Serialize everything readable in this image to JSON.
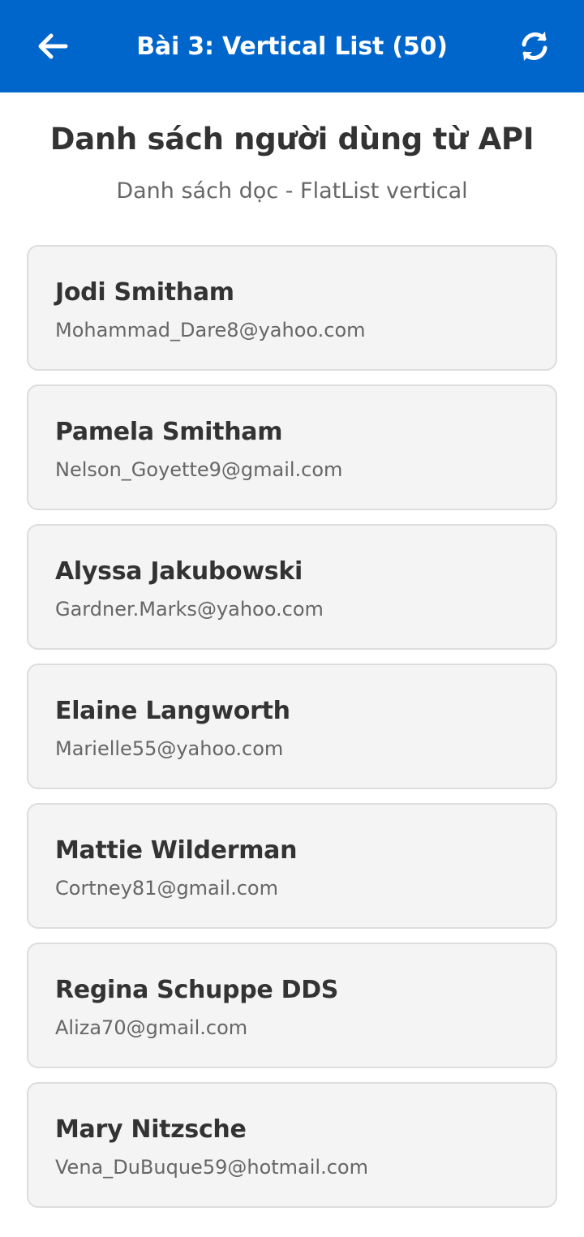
{
  "header": {
    "title": "Bài 3: Vertical List (50)",
    "back_icon": "arrow-left-icon",
    "refresh_icon": "refresh-icon",
    "background": "#0066CC"
  },
  "main": {
    "title": "Danh sách người dùng từ API",
    "subtitle": "Danh sách dọc - FlatList vertical"
  },
  "users": [
    {
      "name": "Jodi Smitham",
      "email": "Mohammad_Dare8@yahoo.com"
    },
    {
      "name": "Pamela Smitham",
      "email": "Nelson_Goyette9@gmail.com"
    },
    {
      "name": "Alyssa Jakubowski",
      "email": "Gardner.Marks@yahoo.com"
    },
    {
      "name": "Elaine Langworth",
      "email": "Marielle55@yahoo.com"
    },
    {
      "name": "Mattie Wilderman",
      "email": "Cortney81@gmail.com"
    },
    {
      "name": "Regina Schuppe DDS",
      "email": "Aliza70@gmail.com"
    },
    {
      "name": "Mary Nitzsche",
      "email": "Vena_DuBuque59@hotmail.com"
    }
  ]
}
